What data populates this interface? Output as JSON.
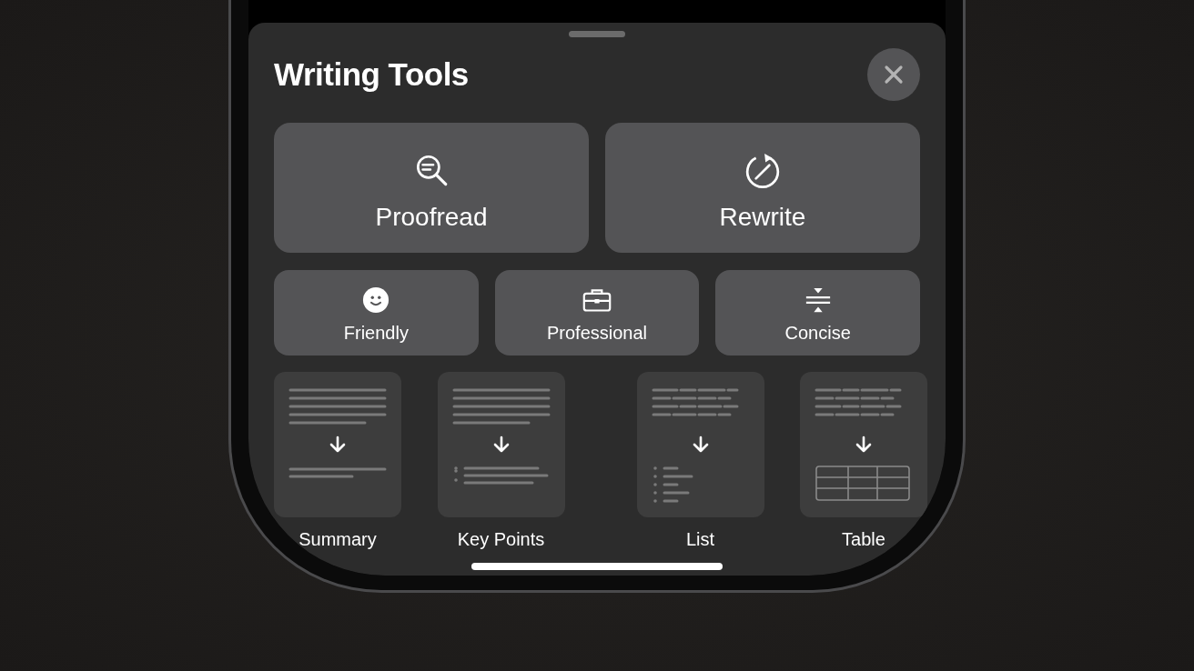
{
  "sheet": {
    "title": "Writing Tools",
    "primary_actions": [
      {
        "kind": "proofread",
        "label": "Proofread"
      },
      {
        "kind": "rewrite",
        "label": "Rewrite"
      }
    ],
    "tone_actions": [
      {
        "kind": "friendly",
        "label": "Friendly"
      },
      {
        "kind": "professional",
        "label": "Professional"
      },
      {
        "kind": "concise",
        "label": "Concise"
      }
    ],
    "format_actions": [
      {
        "kind": "summary",
        "label": "Summary"
      },
      {
        "kind": "key_points",
        "label": "Key Points"
      },
      {
        "kind": "list",
        "label": "List"
      },
      {
        "kind": "table",
        "label": "Table"
      }
    ]
  }
}
